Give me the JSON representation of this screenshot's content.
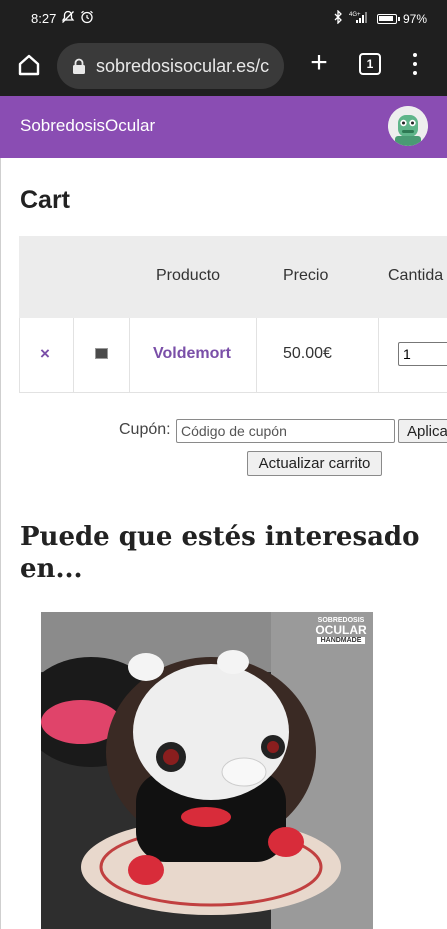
{
  "statusbar": {
    "time": "8:27",
    "battery": "97%",
    "network": "4G+"
  },
  "browser": {
    "url": "sobredosisocular.es/c",
    "tab_count": "1"
  },
  "site": {
    "title": "SobredosisOcular"
  },
  "page": {
    "title": "Cart"
  },
  "cart": {
    "headers": [
      "Producto",
      "Precio",
      "Cantida"
    ],
    "items": [
      {
        "remove": "×",
        "name": "Voldemort",
        "price": "50.00€",
        "quantity": "1"
      }
    ]
  },
  "coupon": {
    "label": "Cupón:",
    "placeholder": "Código de cupón",
    "apply_label": "Aplicar cupón",
    "update_label": "Actualizar carrito"
  },
  "related": {
    "title": "Puede que estés interesado en..."
  },
  "product_image": {
    "watermark_line1": "SOBREDOSIS",
    "watermark_line2": "OCULAR",
    "watermark_line3": "HANDMADE"
  },
  "colors": {
    "brand": "#8a4db3",
    "link": "#7a4fa8",
    "chrome": "#1f1f1f"
  }
}
